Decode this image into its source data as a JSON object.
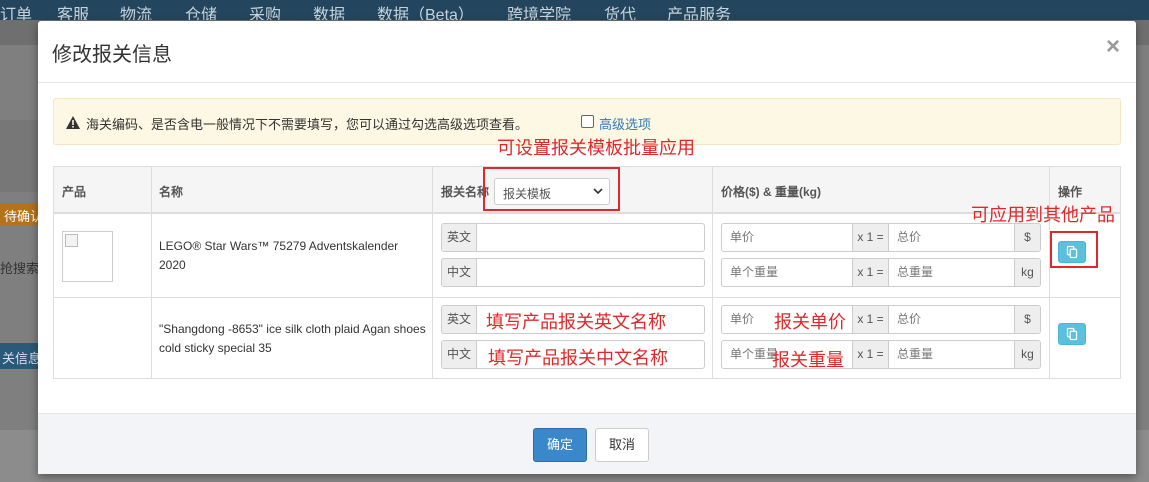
{
  "background": {
    "nav_items": [
      "订单",
      "客服",
      "物流",
      "仓储",
      "采购",
      "数据",
      "数据（Beta）",
      "跨境学院",
      "货代",
      "产品服务"
    ],
    "side_pending": "待确认",
    "side_search": "抢搜索",
    "side_info": "关信息"
  },
  "modal": {
    "title": "修改报关信息",
    "close_glyph": "×"
  },
  "alert": {
    "icon": "warning-icon",
    "text": "海关编码、是否含电一般情况下不需要填写，您可以通过勾选高级选项查看。",
    "advanced_label": "高级选项"
  },
  "table": {
    "headers": {
      "product": "产品",
      "name": "名称",
      "customs_name": "报关名称",
      "price_weight": "价格($) & 重量(kg)",
      "action": "操作"
    },
    "template_select": "报关模板",
    "rows": [
      {
        "name": "LEGO® Star Wars™ 75279 Adventskalender 2020",
        "en_label": "英文",
        "cn_label": "中文",
        "en_value": "",
        "cn_value": "",
        "unit_price_placeholder": "单价",
        "multiplier": "x 1 =",
        "total_price_placeholder": "总价",
        "currency": "$",
        "unit_weight_placeholder": "单个重量",
        "total_weight_placeholder": "总重量",
        "weight_unit": "kg"
      },
      {
        "name": "\"Shangdong -8653\" ice silk cloth plaid Agan shoes cold sticky special 35",
        "en_label": "英文",
        "cn_label": "中文",
        "en_value": "",
        "cn_value": "",
        "unit_price_placeholder": "单价",
        "multiplier": "x 1 =",
        "total_price_placeholder": "总价",
        "currency": "$",
        "unit_weight_placeholder": "单个重量",
        "total_weight_placeholder": "总重量",
        "weight_unit": "kg"
      }
    ]
  },
  "annotations": {
    "template_note": "可设置报关模板批量应用",
    "apply_note": "可应用到其他产品",
    "en_name_note": "填写产品报关英文名称",
    "cn_name_note": "填写产品报关中文名称",
    "unit_price_note": "报关单价",
    "weight_note": "报关重量",
    "color": "#e0282a"
  },
  "footer": {
    "confirm": "确定",
    "cancel": "取消"
  },
  "colors": {
    "primary": "#3a87c9",
    "info": "#5bc0de",
    "warning_bg": "#fcf8e3",
    "link": "#337ab7"
  }
}
